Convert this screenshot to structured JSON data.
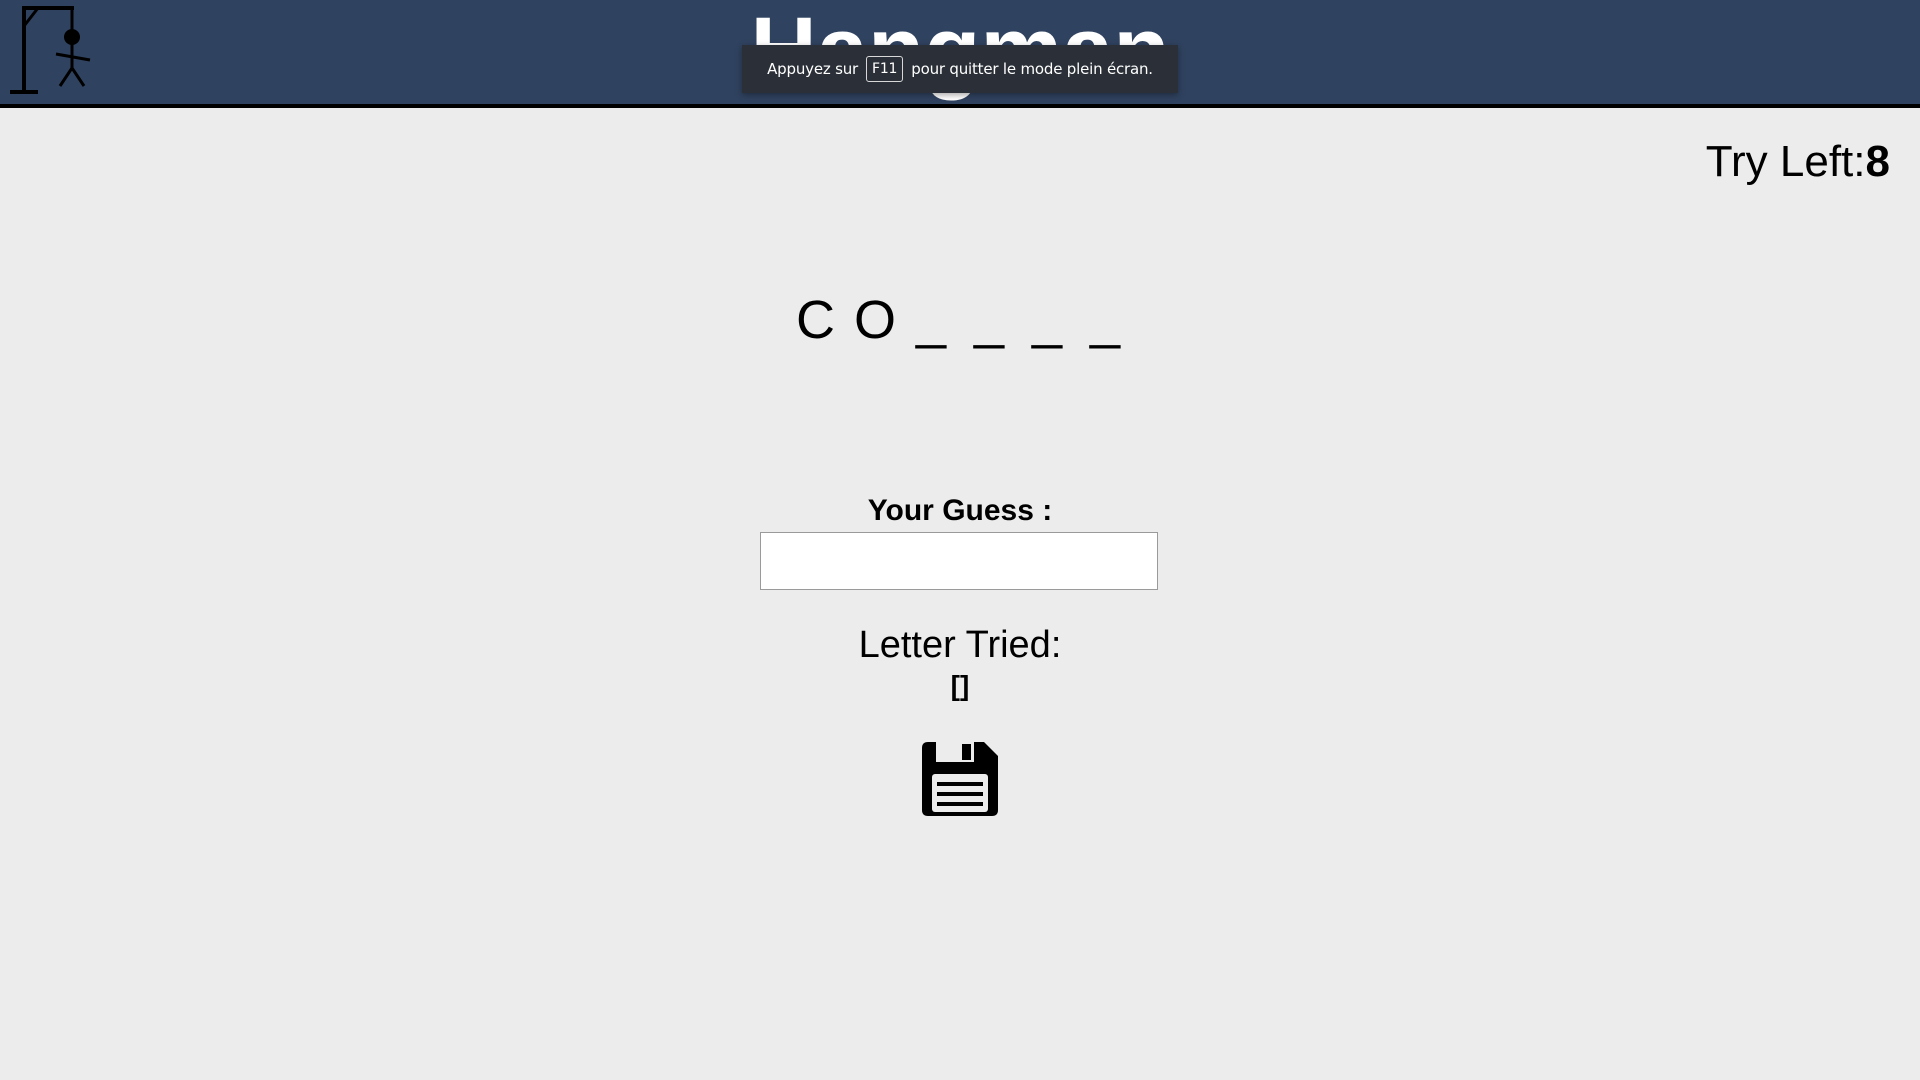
{
  "header": {
    "title": "Hangman",
    "logo_icon": "hangman-gallows-icon",
    "background": "#2f425f"
  },
  "fullscreen_notice": {
    "before": "Appuyez sur",
    "key": "F11",
    "after": "pour quitter le mode plein écran."
  },
  "status": {
    "try_left_label": "Try Left:",
    "try_left_value": "8"
  },
  "word": {
    "letters": [
      "C",
      "O",
      "_",
      "_",
      "_",
      "_"
    ]
  },
  "guess": {
    "label": "Your Guess :",
    "value": "",
    "placeholder": ""
  },
  "tried": {
    "label": "Letter Tried:",
    "value": "[]"
  },
  "save_button": {
    "icon": "floppy-disk-icon"
  }
}
